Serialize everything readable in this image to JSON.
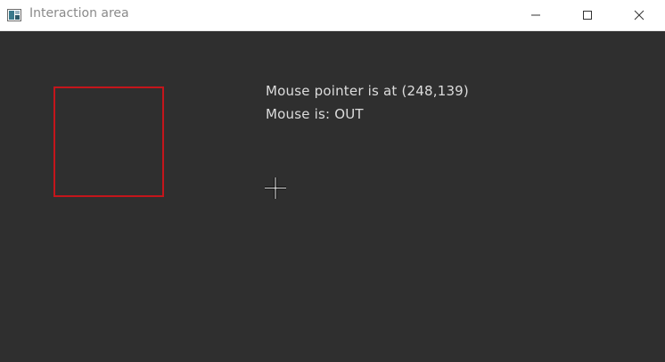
{
  "window": {
    "title": "Interaction area",
    "icon": "opencv-window-icon",
    "controls": [
      "minimize",
      "maximize",
      "close"
    ]
  },
  "canvas": {
    "background_color": "#2f2f2f",
    "region_color": "#c4151b",
    "pointer_text": "Mouse pointer is at (248,139)",
    "status_text": "Mouse is: OUT",
    "cursor_icon": "crosshair-icon"
  }
}
